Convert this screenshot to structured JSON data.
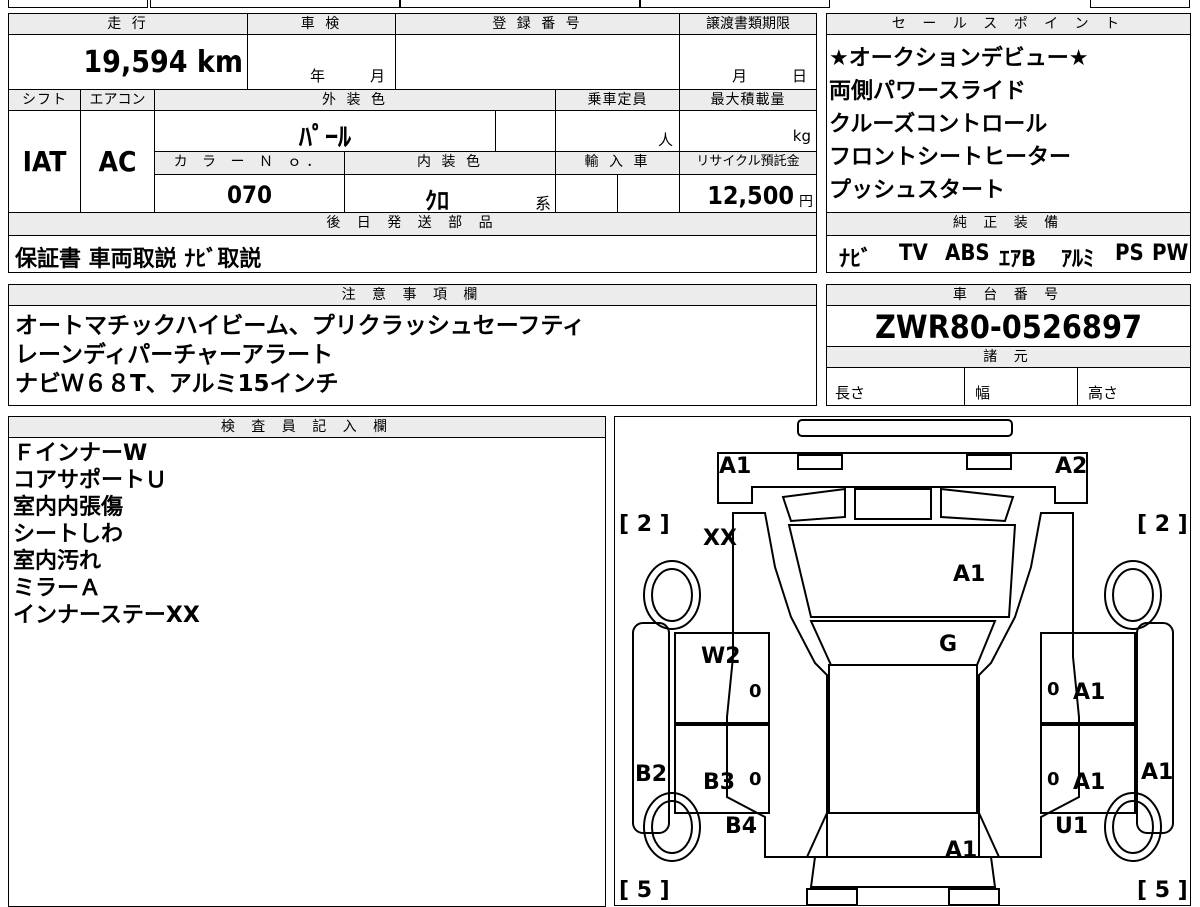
{
  "spec": {
    "mileage_label": "走 行",
    "mileage_value": "19,594 km",
    "shaken_label": "車 検",
    "shaken_year": "年",
    "shaken_month": "月",
    "regno_label": "登 録 番 号",
    "transfer_label": "譲渡書類期限",
    "transfer_month": "月",
    "transfer_day": "日",
    "shift_label": "シフト",
    "shift_value": "IAT",
    "ac_label": "エアコン",
    "ac_value": "AC",
    "exterior_label": "外 装 色",
    "exterior_value": "ﾊﾟｰﾙ",
    "capacity_label": "乗車定員",
    "capacity_unit": "人",
    "maxload_label": "最大積載量",
    "maxload_unit": "kg",
    "colorno_label": "カ ラ ー Ｎ ｏ．",
    "colorno_value": "070",
    "interior_label": "内 装 色",
    "interior_value": "ｸﾛ",
    "interior_suffix": "系",
    "import_label": "輸 入 車",
    "recycle_label": "リサイクル預託金",
    "recycle_value": "12,500",
    "recycle_unit": "円"
  },
  "later_parts": {
    "header": "後 日 発 送 部 品",
    "text": "保証書 車両取説 ﾅﾋﾞ取説"
  },
  "sales_points": {
    "header": "セ ー ル ス ポ イ ン ト",
    "items": [
      "★オークションデビュー★",
      "両側パワースライド",
      "クルーズコントロール",
      "フロントシートヒーター",
      "プッシュスタート"
    ]
  },
  "equipment": {
    "header": "純 正 装 備",
    "items": [
      "ﾅﾋﾞ",
      "TV",
      "ABS",
      "ｴｱB",
      "ｱﾙﾐ",
      "PS",
      "PW"
    ]
  },
  "notes": {
    "header": "注 意 事 項 欄",
    "lines": [
      "オートマチックハイビーム、プリクラッシュセーフティ",
      "レーンディパーチャーアラート",
      "ナビＷ６８T、アルミ15インチ"
    ]
  },
  "chassis": {
    "header": "車 台 番 号",
    "value": "ZWR80-0526897",
    "specs_header": "諸 元",
    "length_label": "長さ",
    "width_label": "幅",
    "height_label": "高さ"
  },
  "inspector": {
    "header": "検 査 員 記 入 欄",
    "lines": [
      "ＦインナーW",
      "コアサポートＵ",
      "室内内張傷",
      "シートしわ",
      "室内汚れ",
      "ミラーＡ",
      "インナーステーXX"
    ]
  },
  "diagram": {
    "marks": {
      "top_left": "A1",
      "top_right": "A2",
      "bracket_tl": "[ 2 ]",
      "bracket_tr": "[ 2 ]",
      "fender_left": "XX",
      "hood": "A1",
      "windshield": "G",
      "front_door_left": "W2",
      "front_door_left_zero": "0",
      "front_door_right_zero": "0",
      "front_door_right": "A1",
      "pillar_left": "B2",
      "rear_door_left": "B3",
      "rear_door_left_zero": "0",
      "rear_door_right_zero": "0",
      "rear_door_right": "A1",
      "pillar_right": "A1",
      "quarter_left": "B4",
      "quarter_right": "U1",
      "rear_panel": "A1",
      "bracket_bl": "[ 5 ]",
      "bracket_br": "[ 5 ]"
    }
  }
}
